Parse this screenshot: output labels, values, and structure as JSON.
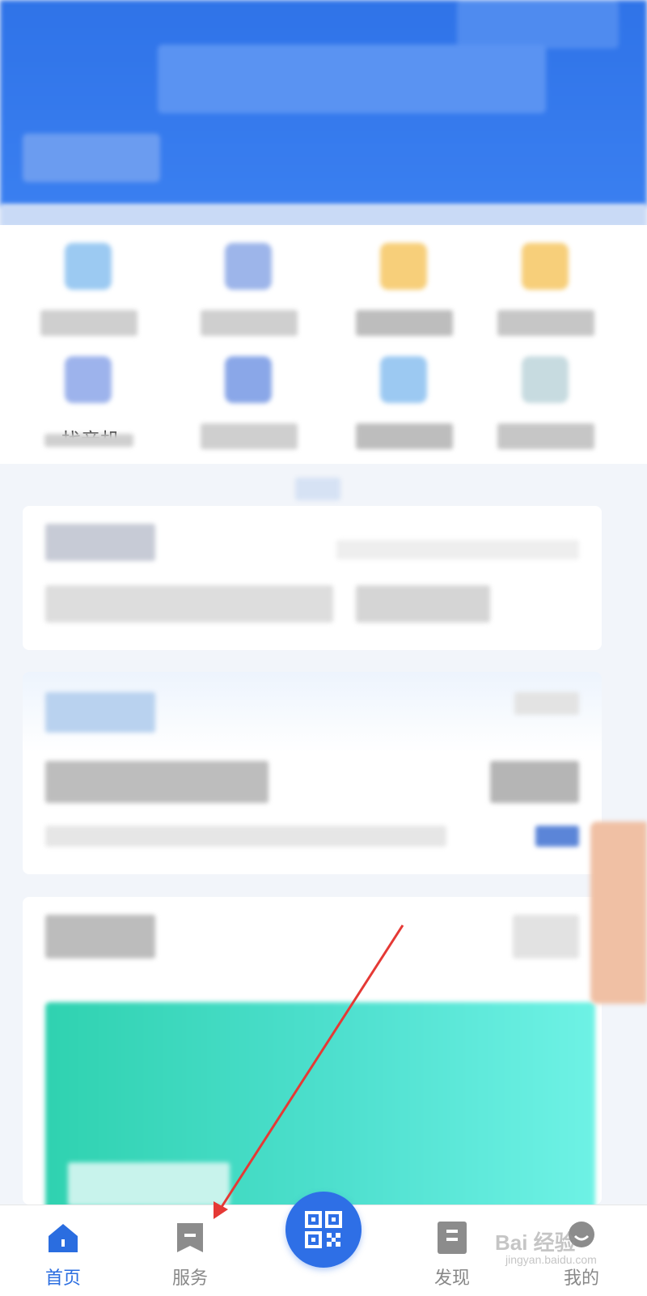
{
  "grid": {
    "partial_label": "找音机"
  },
  "bottom_nav": {
    "items": [
      {
        "label": "首页",
        "icon": "home-icon",
        "active": true
      },
      {
        "label": "服务",
        "icon": "service-icon",
        "active": false
      },
      {
        "label": "发现",
        "icon": "discover-icon",
        "active": false
      },
      {
        "label": "我的",
        "icon": "profile-icon",
        "active": false
      }
    ],
    "scan_icon": "qr-code-icon"
  },
  "watermark": {
    "text": "Bai 经验",
    "sub": "jingyan.baidu.com"
  },
  "colors": {
    "primary": "#2e6fe6",
    "banner": "#3fd9c0",
    "annotation": "#e53935"
  }
}
